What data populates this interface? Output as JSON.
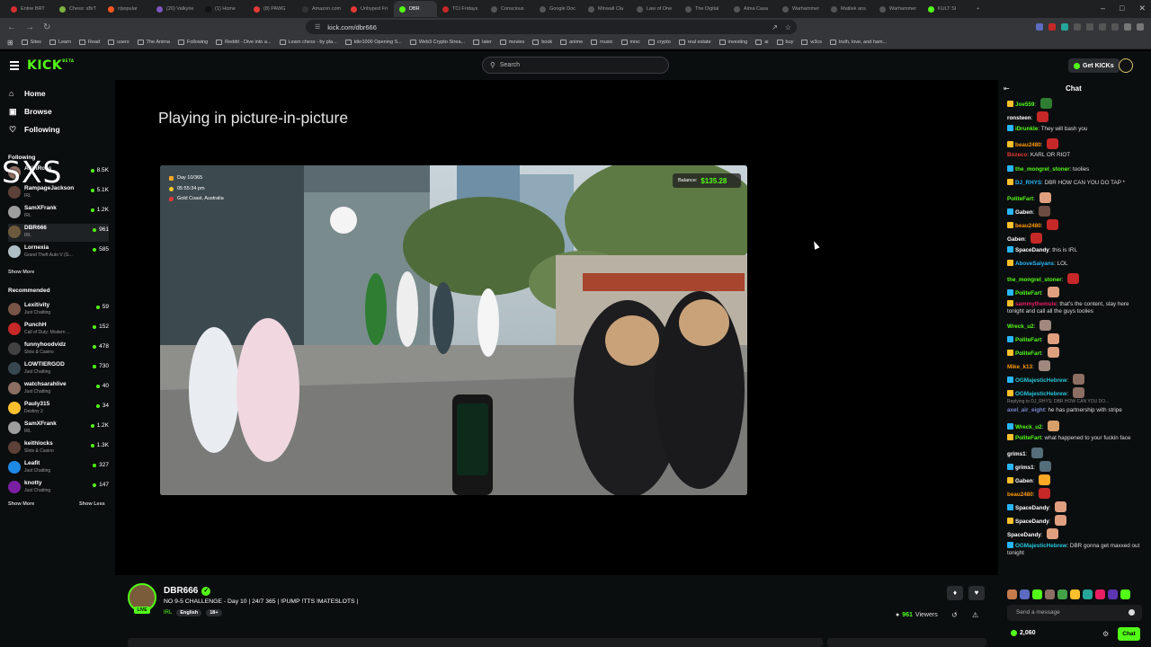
{
  "browser": {
    "tabs": [
      {
        "label": "Entire BRT",
        "color": "#d32f2f"
      },
      {
        "label": "Chess: sBrT",
        "color": "#7cb342"
      },
      {
        "label": "r/popular",
        "color": "#ff5722"
      },
      {
        "label": "(20) Valkyrie",
        "color": "#7e57c2"
      },
      {
        "label": "(1) Home",
        "color": "#111"
      },
      {
        "label": "(8) PAWG",
        "color": "#e53935"
      },
      {
        "label": "Amazon.com",
        "color": "#333"
      },
      {
        "label": "Unhyped Fri",
        "color": "#e53935"
      },
      {
        "label": "DBR",
        "color": "#53fc18",
        "active": true
      },
      {
        "label": "TCI Fridays",
        "color": "#c62828"
      },
      {
        "label": "Conscious",
        "color": "#555"
      },
      {
        "label": "Google Doc",
        "color": "#555"
      },
      {
        "label": "Minwall Cla",
        "color": "#555"
      },
      {
        "label": "Law of One",
        "color": "#555"
      },
      {
        "label": "The Digital",
        "color": "#555"
      },
      {
        "label": "Alma Casa",
        "color": "#555"
      },
      {
        "label": "Warhammer",
        "color": "#555"
      },
      {
        "label": "Matilek ans",
        "color": "#555"
      },
      {
        "label": "Warhammer",
        "color": "#555"
      },
      {
        "label": "KULT SI",
        "color": "#53fc18"
      }
    ],
    "new_tab": "+",
    "url": "kick.com/dbr666",
    "bookmarks": [
      "Sites",
      "Learn",
      "Read",
      "users",
      "The Anima",
      "Following",
      "Reddit - Dive into a...",
      "Learn chess - by pla...",
      "ktkr1000 Opening S...",
      "Web3 Crypto Strea...",
      "later",
      "movies",
      "book",
      "anime",
      "music",
      "misc",
      "crypto",
      "real estate",
      "investing",
      "ai",
      "buy",
      "w3cs",
      "truth, love, and ham..."
    ]
  },
  "header": {
    "logo": "KICK",
    "logo_sup": "BETA",
    "search_placeholder": "Search",
    "get_kicks": "Get KICKs"
  },
  "sidebar": {
    "nav": [
      {
        "label": "Home",
        "icon": "home-icon"
      },
      {
        "label": "Browse",
        "icon": "browse-icon"
      },
      {
        "label": "Following",
        "icon": "heart-icon"
      }
    ],
    "following_label": "Following",
    "following": [
      {
        "name": "AdinRoss",
        "category": "",
        "viewers": "8.5K",
        "color": "#8d6e63"
      },
      {
        "name": "RampageJackson",
        "category": "IRL",
        "viewers": "5.1K",
        "color": "#5d4037"
      },
      {
        "name": "SamXFrank",
        "category": "IRL",
        "viewers": "1.2K",
        "color": "#9e9e9e"
      },
      {
        "name": "DBR666",
        "category": "IRL",
        "viewers": "961",
        "color": "#6d5a3c",
        "active": true
      },
      {
        "name": "Lornexia",
        "category": "Grand Theft Auto V (G...",
        "viewers": "585",
        "color": "#b0bec5"
      }
    ],
    "show_more_1": "Show More",
    "recommended_label": "Recommended",
    "recommended": [
      {
        "name": "Lexitivity",
        "category": "Just Chatting",
        "viewers": "59",
        "color": "#795548"
      },
      {
        "name": "PunchH",
        "category": "Call of Duty: Modern ...",
        "viewers": "152",
        "color": "#c62828"
      },
      {
        "name": "funnyhoodvidz",
        "category": "Slots & Casino",
        "viewers": "478",
        "color": "#424242"
      },
      {
        "name": "LOWTIERGOD",
        "category": "Just Chatting",
        "viewers": "730",
        "color": "#37474f"
      },
      {
        "name": "watchsarahlive",
        "category": "Just Chatting",
        "viewers": "40",
        "color": "#8d6e63"
      },
      {
        "name": "Pauly315",
        "category": "Destiny 2",
        "viewers": "34",
        "color": "#fbc02d"
      },
      {
        "name": "SamXFrank",
        "category": "IRL",
        "viewers": "1.2K",
        "color": "#9e9e9e"
      },
      {
        "name": "keithlocks",
        "category": "Slots & Casino",
        "viewers": "1.3K",
        "color": "#5d4037"
      },
      {
        "name": "Leafit",
        "category": "Just Chatting",
        "viewers": "327",
        "color": "#1e88e5"
      },
      {
        "name": "knotty",
        "category": "Just Chatting",
        "viewers": "147",
        "color": "#7b1fa2"
      }
    ],
    "show_more_2": "Show More",
    "show_less": "Show Less",
    "watermark": "SXS"
  },
  "main": {
    "pip_text": "Playing in picture-in-picture",
    "overlay": {
      "day": "Day 10/365",
      "time": "05:55:34 pm",
      "location": "Gold Coast, Australia",
      "balance_label": "Balance:",
      "balance_value": "$135.28"
    }
  },
  "stream": {
    "name": "DBR666",
    "title": "NO 9-5 CHALLENGE - Day 10 | 24/7 365 | !PUMP !TTS !MATESLOTS |",
    "category": "IRL",
    "tags": [
      "English",
      "18+"
    ],
    "live": "LIVE",
    "viewers": "961",
    "viewers_label": "Viewers"
  },
  "chat": {
    "title": "Chat",
    "messages": [
      {
        "user": "Joe559",
        "text": "",
        "color": "#53fc18",
        "emote": "#2e7d32"
      },
      {
        "user": "ronsteen",
        "text": "",
        "color": "#ffffff",
        "emote": "#c62828"
      },
      {
        "user": "iDrunkle",
        "text": "They will bash you",
        "color": "#53fc18"
      },
      {
        "user": "beau2480",
        "text": "",
        "color": "#ff9800",
        "emote": "#c62828"
      },
      {
        "user": "Bozeco",
        "text": "KARL OR RIOT",
        "color": "#e53935"
      },
      {
        "user": "the_mongrel_stoner",
        "text": "toolies",
        "color": "#53fc18"
      },
      {
        "user": "DJ_RHYS",
        "text": "DBR HOW CAN YOU DO TAP *",
        "color": "#29b6f6"
      },
      {
        "user": "PoliteFart",
        "text": "",
        "color": "#53fc18",
        "emote": "#e0a080"
      },
      {
        "user": "Gaben",
        "text": "",
        "color": "#ffffff",
        "emote": "#6d4c41"
      },
      {
        "user": "beau2480",
        "text": "",
        "color": "#ff9800",
        "emote": "#c62828"
      },
      {
        "user": "Gaben",
        "text": "",
        "color": "#ffffff",
        "emote": "#c62828"
      },
      {
        "user": "SpaceDandy",
        "text": "this is IRL",
        "color": "#ffffff"
      },
      {
        "user": "AboveSaiyans",
        "text": "LOL",
        "color": "#29b6f6"
      },
      {
        "user": "the_mongrel_stoner",
        "text": "",
        "color": "#53fc18",
        "emote": "#c62828"
      },
      {
        "user": "PoliteFart",
        "text": "",
        "color": "#53fc18",
        "emote": "#e0a080"
      },
      {
        "user": "sammythemule",
        "text": "that's the content, stay here tonight and call all the guys toolies",
        "color": "#e91e63"
      },
      {
        "user": "Wreck_u2",
        "text": "",
        "color": "#53fc18",
        "emote": "#a1887f"
      },
      {
        "user": "PoliteFart",
        "text": "",
        "color": "#53fc18",
        "emote": "#e0a080"
      },
      {
        "user": "PoliteFart",
        "text": "",
        "color": "#53fc18",
        "emote": "#e0a080"
      },
      {
        "user": "Mike_k13",
        "text": "",
        "color": "#ff9800",
        "emote": "#a1887f"
      },
      {
        "user": "OGMajesticHebrew",
        "text": "",
        "color": "#26c6da",
        "emote": "#8d6e63"
      },
      {
        "user": "OGMajesticHebrew",
        "text": "",
        "color": "#26c6da",
        "emote": "#8d6e63"
      },
      {
        "user": "axel_air_eight",
        "text": "he has partnership with stripe",
        "color": "#7986cb",
        "reply": "Replying to DJ_RHYS: DBR HOW CAN YOU DO..."
      },
      {
        "user": "Wreck_u2",
        "text": "",
        "color": "#53fc18",
        "emote": "#d7a06a"
      },
      {
        "user": "PoliteFart",
        "text": "what happened to your fuckin face",
        "color": "#53fc18"
      },
      {
        "user": "grims1",
        "text": "",
        "color": "#ffffff",
        "emote": "#546e7a"
      },
      {
        "user": "grims1",
        "text": "",
        "color": "#ffffff",
        "emote": "#546e7a"
      },
      {
        "user": "Gaben",
        "text": "",
        "color": "#ffffff",
        "emote": "#f9a825"
      },
      {
        "user": "beau2480",
        "text": "",
        "color": "#ff9800",
        "emote": "#c62828"
      },
      {
        "user": "SpaceDandy",
        "text": "",
        "color": "#ffffff",
        "emote": "#e0a080"
      },
      {
        "user": "SpaceDandy",
        "text": "",
        "color": "#ffffff",
        "emote": "#e0a080"
      },
      {
        "user": "SpaceDandy",
        "text": "",
        "color": "#ffffff",
        "emote": "#e0a080"
      },
      {
        "user": "OGMajesticHebrew",
        "text": "DBR gonna get maxxed out tonight",
        "color": "#26c6da"
      }
    ],
    "input_placeholder": "Send a message",
    "points": "2,060",
    "send_label": "Chat"
  },
  "colors": {
    "accent": "#53fc18",
    "bg": "#0b0e0f"
  }
}
